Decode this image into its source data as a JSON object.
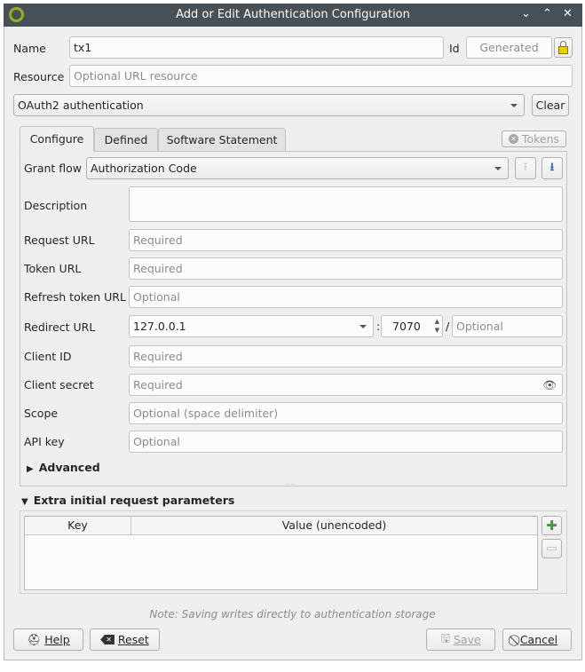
{
  "window": {
    "title": "Add or Edit Authentication Configuration"
  },
  "name": {
    "label": "Name",
    "value": "tx1"
  },
  "id": {
    "label": "Id",
    "placeholder": "Generated"
  },
  "resource": {
    "label": "Resource",
    "placeholder": "Optional URL resource"
  },
  "method": {
    "value": "OAuth2 authentication",
    "clear": "Clear"
  },
  "tabs": [
    {
      "label": "Configure",
      "active": true
    },
    {
      "label": "Defined"
    },
    {
      "label": "Software Statement"
    }
  ],
  "tokens_label": "Tokens",
  "form": {
    "grant_flow": {
      "label": "Grant flow",
      "value": "Authorization Code"
    },
    "description": {
      "label": "Description"
    },
    "request_url": {
      "label": "Request URL",
      "placeholder": "Required"
    },
    "token_url": {
      "label": "Token URL",
      "placeholder": "Required"
    },
    "refresh_url": {
      "label": "Refresh token URL",
      "placeholder": "Optional"
    },
    "redirect": {
      "label": "Redirect URL",
      "host": "127.0.0.1",
      "sep1": ":",
      "port": "7070",
      "sep2": "/",
      "path_placeholder": "Optional"
    },
    "client_id": {
      "label": "Client ID",
      "placeholder": "Required"
    },
    "client_secret": {
      "label": "Client secret",
      "placeholder": "Required"
    },
    "scope": {
      "label": "Scope",
      "placeholder": "Optional (space delimiter)"
    },
    "api_key": {
      "label": "API key",
      "placeholder": "Optional"
    },
    "advanced": "Advanced"
  },
  "extra": {
    "title": "Extra initial request parameters",
    "columns": [
      "Key",
      "Value (unencoded)"
    ]
  },
  "note": "Note: Saving writes directly to authentication storage",
  "buttons": {
    "help": "Help",
    "reset": "Reset",
    "save": "Save",
    "cancel": "Cancel"
  },
  "colors": {
    "titlebar": "#475057",
    "window": "#efefef",
    "lock": "#e8d000",
    "add": "#3a9a3a"
  }
}
